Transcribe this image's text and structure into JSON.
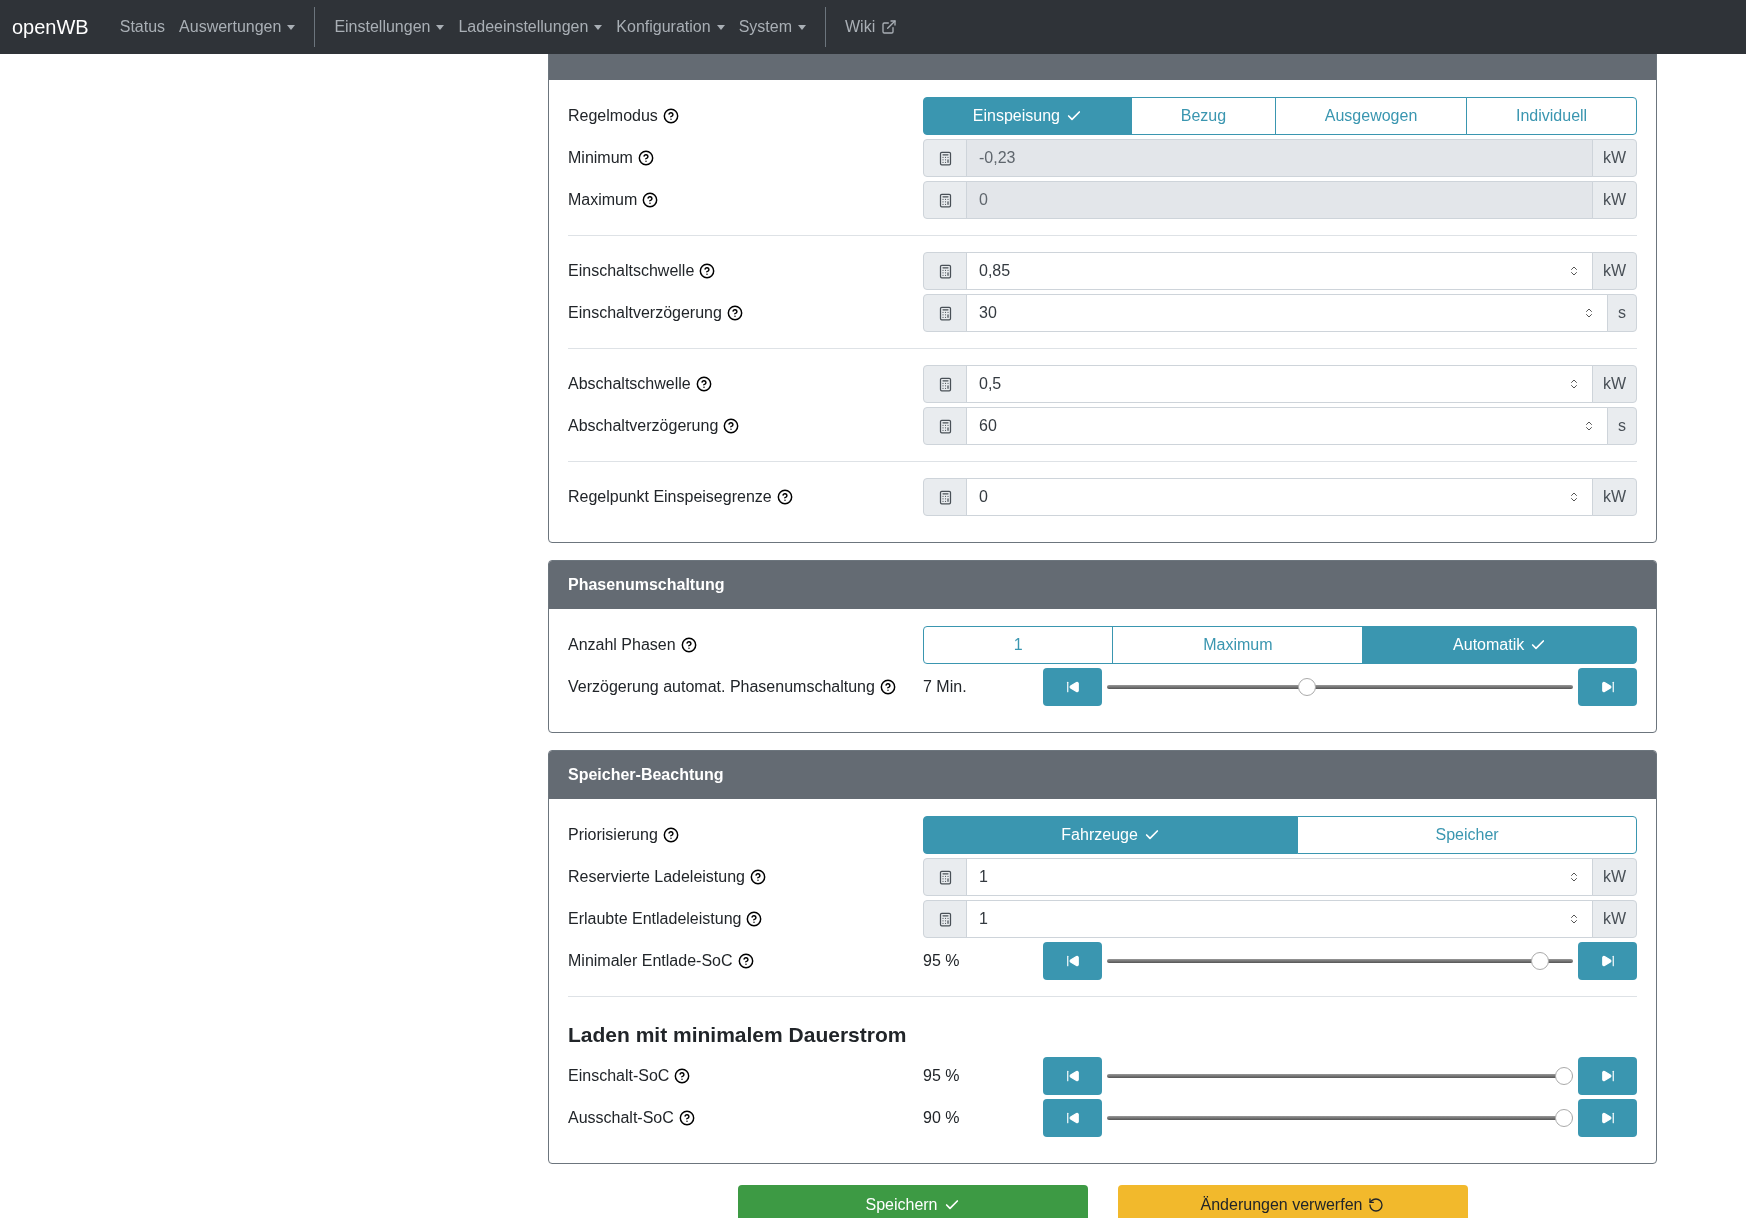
{
  "navbar": {
    "brand": "openWB",
    "groups": [
      [
        {
          "label": "Status",
          "kind": "link"
        },
        {
          "label": "Auswertungen",
          "kind": "dropdown"
        }
      ],
      [
        {
          "label": "Einstellungen",
          "kind": "dropdown"
        },
        {
          "label": "Ladeeinstellungen",
          "kind": "dropdown"
        },
        {
          "label": "Konfiguration",
          "kind": "dropdown"
        },
        {
          "label": "System",
          "kind": "dropdown"
        }
      ],
      [
        {
          "label": "Wiki",
          "kind": "external"
        }
      ]
    ]
  },
  "cards": [
    {
      "rows": [
        {
          "kind": "segmented",
          "label": "Regelmodus",
          "options": [
            {
              "label": "Einspeisung",
              "selected": true
            },
            {
              "label": "Bezug",
              "selected": false
            },
            {
              "label": "Ausgewogen",
              "selected": false
            },
            {
              "label": "Individuell",
              "selected": false
            }
          ]
        },
        {
          "kind": "input",
          "label": "Minimum",
          "value": "-0,23",
          "unit": "kW",
          "readonly": true
        },
        {
          "kind": "input",
          "label": "Maximum",
          "value": "0",
          "unit": "kW",
          "readonly": true
        },
        {
          "kind": "divider"
        },
        {
          "kind": "input",
          "label": "Einschaltschwelle",
          "value": "0,85",
          "unit": "kW",
          "readonly": false
        },
        {
          "kind": "input",
          "label": "Einschaltverzögerung",
          "value": "30",
          "unit": "s",
          "readonly": false
        },
        {
          "kind": "divider"
        },
        {
          "kind": "input",
          "label": "Abschaltschwelle",
          "value": "0,5",
          "unit": "kW",
          "readonly": false
        },
        {
          "kind": "input",
          "label": "Abschaltverzögerung",
          "value": "60",
          "unit": "s",
          "readonly": false
        },
        {
          "kind": "divider"
        },
        {
          "kind": "input",
          "label": "Regelpunkt Einspeisegrenze",
          "value": "0",
          "unit": "kW",
          "readonly": false
        }
      ]
    },
    {
      "title": "Phasenumschaltung",
      "rows": [
        {
          "kind": "segmented",
          "label": "Anzahl Phasen",
          "options": [
            {
              "label": "1",
              "selected": false
            },
            {
              "label": "Maximum",
              "selected": false
            },
            {
              "label": "Automatik",
              "selected": true
            }
          ]
        },
        {
          "kind": "slider",
          "label": "Verzögerung automat. Phasenumschaltung",
          "reading": "7 Min.",
          "level": 0.43
        }
      ]
    },
    {
      "title": "Speicher-Beachtung",
      "rows": [
        {
          "kind": "segmented",
          "label": "Priorisierung",
          "options": [
            {
              "label": "Fahrzeuge",
              "selected": true
            },
            {
              "label": "Speicher",
              "selected": false
            }
          ]
        },
        {
          "kind": "input",
          "label": "Reservierte Ladeleistung",
          "value": "1",
          "unit": "kW",
          "readonly": false
        },
        {
          "kind": "input",
          "label": "Erlaubte Entladeleistung",
          "value": "1",
          "unit": "kW",
          "readonly": false
        },
        {
          "kind": "slider",
          "label": "Minimaler Entlade-SoC",
          "reading": "95 %",
          "level": 0.93
        },
        {
          "kind": "divider"
        },
        {
          "kind": "heading",
          "label": "Laden mit minimalem Dauerstrom"
        },
        {
          "kind": "slider",
          "label": "Einschalt-SoC",
          "reading": "95 %",
          "level": 0.98
        },
        {
          "kind": "slider",
          "label": "Ausschalt-SoC",
          "reading": "90 %",
          "level": 0.98
        }
      ]
    }
  ],
  "footer": [
    {
      "label": "Speichern",
      "kind": "save"
    },
    {
      "label": "Änderungen verwerfen",
      "kind": "discard"
    }
  ]
}
